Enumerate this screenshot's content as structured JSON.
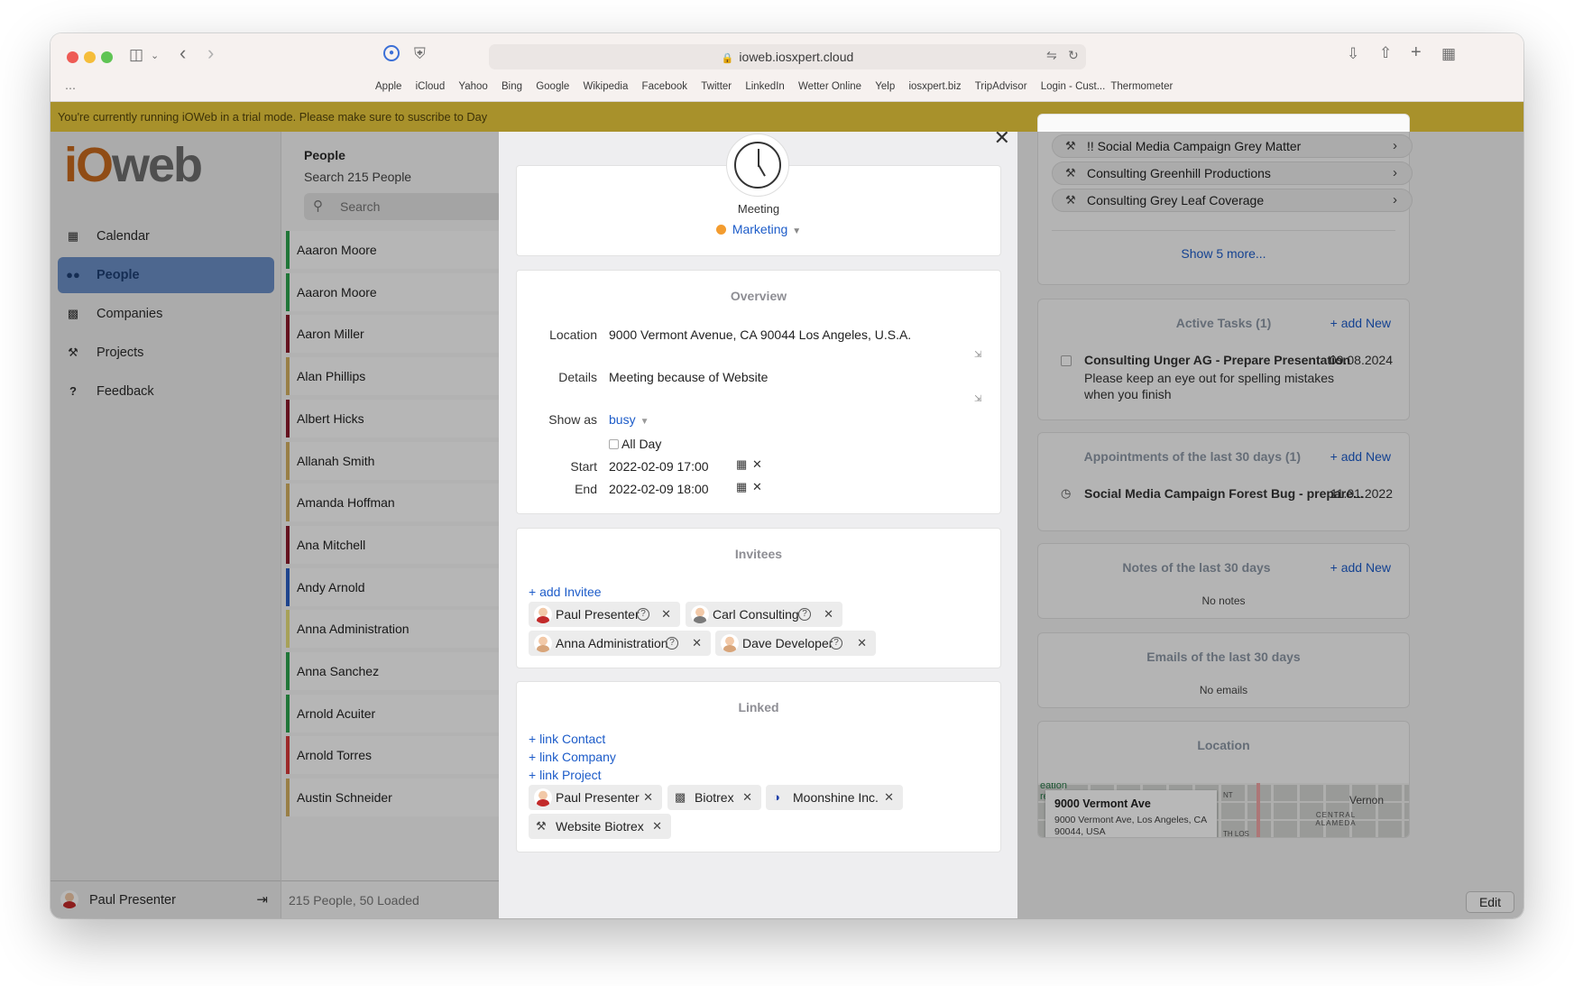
{
  "browser": {
    "url": "ioweb.iosxpert.cloud",
    "bookmarks": [
      "Apple",
      "iCloud",
      "Yahoo",
      "Bing",
      "Google",
      "Wikipedia",
      "Facebook",
      "Twitter",
      "LinkedIn",
      "Wetter Online",
      "Yelp",
      "iosxpert.biz",
      "TripAdvisor",
      "Login - Cust...",
      "Thermometer"
    ]
  },
  "trial_banner": "You're currently running iOWeb in a trial mode. Please make sure to suscribe to Day",
  "sidebar": {
    "logo_i": "iO",
    "logo_web": "web",
    "items": [
      {
        "label": "Calendar",
        "icon": "calendar-icon"
      },
      {
        "label": "People",
        "icon": "people-icon",
        "active": true
      },
      {
        "label": "Companies",
        "icon": "building-icon"
      },
      {
        "label": "Projects",
        "icon": "hammer-icon"
      },
      {
        "label": "Feedback",
        "icon": "question-icon"
      }
    ],
    "user": "Paul Presenter"
  },
  "people_list": {
    "title": "People",
    "subtitle": "Search 215 People",
    "search_placeholder": "Search",
    "rows": [
      {
        "name": "Aaaron Moore",
        "color": "#2da44e"
      },
      {
        "name": "Aaaron Moore",
        "color": "#2da44e"
      },
      {
        "name": "Aaron Miller",
        "color": "#8b1a2b"
      },
      {
        "name": "Alan Phillips",
        "color": "#d4b062"
      },
      {
        "name": "Albert Hicks",
        "color": "#8b1a2b"
      },
      {
        "name": "Allanah Smith",
        "color": "#d4b062"
      },
      {
        "name": "Amanda Hoffman",
        "color": "#d4b062"
      },
      {
        "name": "Ana Mitchell",
        "color": "#8b1a2b"
      },
      {
        "name": "Andy Arnold",
        "color": "#2a5fc4"
      },
      {
        "name": "Anna Administration",
        "color": "#e8e07a"
      },
      {
        "name": "Anna Sanchez",
        "color": "#2da44e"
      },
      {
        "name": "Arnold Acuiter",
        "color": "#2da44e"
      },
      {
        "name": "Arnold Torres",
        "color": "#d93a3a"
      },
      {
        "name": "Austin Schneider",
        "color": "#d4b062"
      }
    ],
    "footer": "215 People, 50 Loaded"
  },
  "right_panel": {
    "projects": [
      "!! Social Media Campaign Grey Matter",
      "Consulting Greenhill Productions",
      "Consulting Grey Leaf Coverage"
    ],
    "show_more": "Show 5 more...",
    "add_new": "+ add New",
    "tasks": {
      "title": "Active Tasks (1)",
      "name": "Consulting Unger AG - Prepare Presentation",
      "date": "09.08.2024",
      "desc": "Please keep an eye out for spelling mistakes when you finish"
    },
    "appointments": {
      "title": "Appointments of the last 30 days (1)",
      "name": "Social Media Campaign Forest Bug - prepare...",
      "date": "11.01.2022"
    },
    "notes": {
      "title": "Notes of the last 30 days",
      "empty": "No notes"
    },
    "emails": {
      "title": "Emails of the last 30 days",
      "empty": "No emails"
    },
    "location": {
      "title": "Location",
      "street": "9000 Vermont Ave",
      "address": "9000 Vermont Ave, Los Angeles, CA 90044, USA",
      "map_labels": [
        "Vernon",
        "CENTRAL ALAMEDA",
        "eation",
        "re",
        "NT",
        "TH LOS"
      ]
    },
    "edit": "Edit"
  },
  "modal": {
    "type": "Meeting",
    "category": "Marketing",
    "category_color": "#f39c2f",
    "overview": {
      "title": "Overview",
      "location_label": "Location",
      "location": "9000 Vermont Avenue, CA 90044 Los Angeles, U.S.A.",
      "details_label": "Details",
      "details": "Meeting because of Website",
      "show_as_label": "Show as",
      "show_as": "busy",
      "all_day": "All Day",
      "start_label": "Start",
      "start": "2022-02-09 17:00",
      "end_label": "End",
      "end": "2022-02-09 18:00"
    },
    "invitees": {
      "title": "Invitees",
      "add": "+ add Invitee",
      "people": [
        "Paul Presenter",
        "Carl Consulting",
        "Anna Administration",
        "Dave Developer"
      ]
    },
    "linked": {
      "title": "Linked",
      "links": [
        "+ link Contact",
        "+ link Company",
        "+ link Project"
      ],
      "items": [
        "Paul Presenter",
        "Biotrex",
        "Moonshine Inc.",
        "Website Biotrex"
      ]
    }
  }
}
